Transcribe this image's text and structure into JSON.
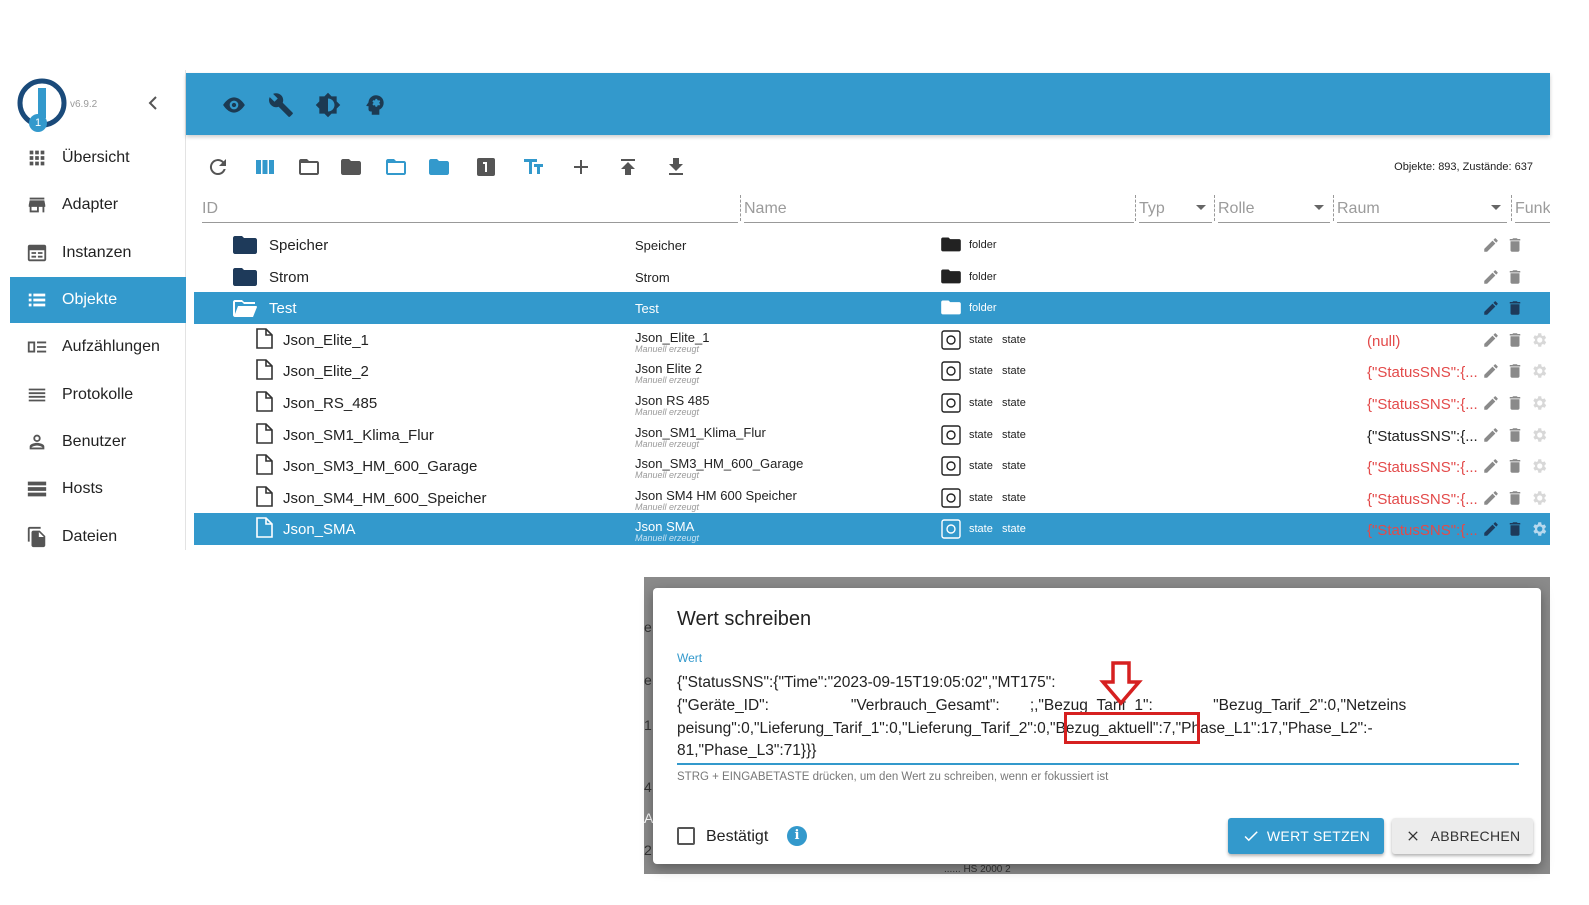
{
  "app": {
    "version": "v6.9.2"
  },
  "sidebar": {
    "items": [
      {
        "label": "Übersicht",
        "icon": "grid-icon"
      },
      {
        "label": "Adapter",
        "icon": "store-icon",
        "badge": "1"
      },
      {
        "label": "Instanzen",
        "icon": "instances-icon"
      },
      {
        "label": "Objekte",
        "icon": "list-icon",
        "active": true
      },
      {
        "label": "Aufzählungen",
        "icon": "enum-icon"
      },
      {
        "label": "Protokolle",
        "icon": "lines-icon"
      },
      {
        "label": "Benutzer",
        "icon": "user-icon"
      },
      {
        "label": "Hosts",
        "icon": "hosts-icon"
      },
      {
        "label": "Dateien",
        "icon": "files-icon"
      }
    ]
  },
  "topbar": {
    "icons": [
      "eye-icon",
      "wrench-icon",
      "brightness-icon",
      "head-icon"
    ],
    "color": "#3399cc"
  },
  "toolbar": {
    "icons": [
      "refresh-icon",
      "columns-icon",
      "folder-open-icon",
      "folder-icon",
      "folder-open-blue-icon",
      "folder-blue-icon",
      "number-one-icon",
      "text-size-icon",
      "add-icon",
      "upload-icon",
      "download-icon"
    ],
    "stats": "Objekte: 893, Zustände: 637"
  },
  "columns": {
    "id": "ID",
    "name": "Name",
    "type": "Typ",
    "role": "Rolle",
    "room": "Raum",
    "func": "Funk"
  },
  "rows": [
    {
      "id": "Speicher",
      "name": "Speicher",
      "sub": "",
      "type": "folder",
      "role": "",
      "value": "",
      "kind": "folder",
      "selected": false
    },
    {
      "id": "Strom",
      "name": "Strom",
      "sub": "",
      "type": "folder",
      "role": "",
      "value": "",
      "kind": "folder",
      "selected": false
    },
    {
      "id": "Test",
      "name": "Test",
      "sub": "",
      "type": "folder",
      "role": "",
      "value": "",
      "kind": "folder-open",
      "selected": true
    },
    {
      "id": "Json_Elite_1",
      "name": "Json_Elite_1",
      "sub": "Manuell erzeugt",
      "type": "state",
      "role": "state",
      "value": "(null)",
      "value_red": true,
      "kind": "file",
      "selected": false
    },
    {
      "id": "Json_Elite_2",
      "name": "Json Elite 2",
      "sub": "Manuell erzeugt",
      "type": "state",
      "role": "state",
      "value": "{\"StatusSNS\":{...",
      "value_red": true,
      "kind": "file",
      "selected": false
    },
    {
      "id": "Json_RS_485",
      "name": "Json RS 485",
      "sub": "Manuell erzeugt",
      "type": "state",
      "role": "state",
      "value": "{\"StatusSNS\":{...",
      "value_red": true,
      "kind": "file",
      "selected": false
    },
    {
      "id": "Json_SM1_Klima_Flur",
      "name": "Json_SM1_Klima_Flur",
      "sub": "Manuell erzeugt",
      "type": "state",
      "role": "state",
      "value": "{\"StatusSNS\":{...",
      "value_red": false,
      "kind": "file",
      "selected": false
    },
    {
      "id": "Json_SM3_HM_600_Garage",
      "name": "Json_SM3_HM_600_Garage",
      "sub": "Manuell erzeugt",
      "type": "state",
      "role": "state",
      "value": "{\"StatusSNS\":{...",
      "value_red": true,
      "kind": "file",
      "selected": false
    },
    {
      "id": "Json_SM4_HM_600_Speicher",
      "name": "Json SM4 HM 600 Speicher",
      "sub": "Manuell erzeugt",
      "type": "state",
      "role": "state",
      "value": "{\"StatusSNS\":{...",
      "value_red": true,
      "kind": "file",
      "selected": false
    },
    {
      "id": "Json_SMA",
      "name": "Json SMA",
      "sub": "Manuell erzeugt",
      "type": "state",
      "role": "state",
      "value": "{\"StatusSNS\":{...",
      "value_red": true,
      "kind": "file",
      "selected": true
    }
  ],
  "dialog": {
    "title": "Wert schreiben",
    "label": "Wert",
    "value_lines": [
      "{\"StatusSNS\":{\"Time\":\"2023-09-15T19:05:02\",\"MT175\":",
      "{\"Geräte_ID\":                   \"Verbrauch_Gesamt\":       ;,\"Bezug_Tarif_1\":              \"Bezug_Tarif_2\":0,\"Netzeins",
      "peisung\":0,\"Lieferung_Tarif_1\":0,\"Lieferung_Tarif_2\":0,\"Bezug_aktuell\":7,\"Phase_L1\":17,\"Phase_L2\":-",
      "81,\"Phase_L3\":71}}}"
    ],
    "help": "STRG + EINGABETASTE drücken, um den Wert zu schreiben, wenn er fokussiert ist",
    "checkbox_label": "Bestätigt",
    "info_glyph": "i",
    "set_label": "WERT SETZEN",
    "cancel_label": "ABBRECHEN",
    "highlight_color": "#d62020"
  },
  "background_fragments": [
    "e",
    "e",
    "1",
    "4",
    "A",
    "2",
    "...... HS 2000 2"
  ]
}
